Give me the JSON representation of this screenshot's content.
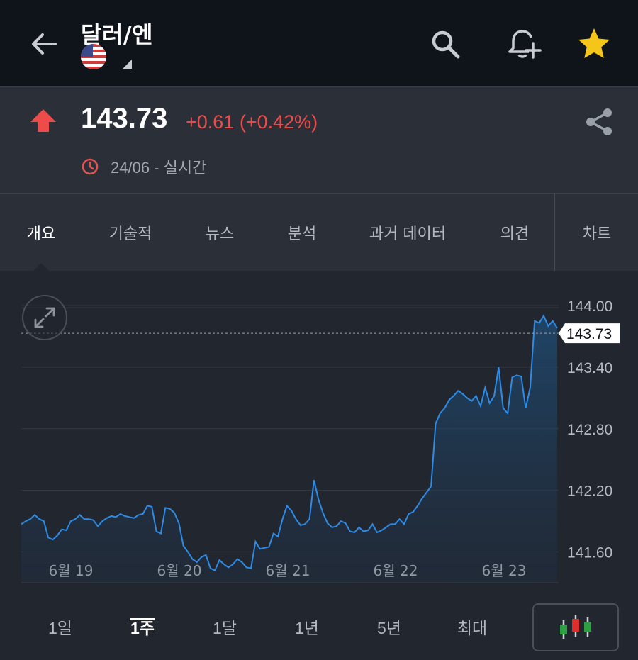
{
  "header": {
    "title": "달러/엔",
    "icons": {
      "back": "back-arrow-icon",
      "search": "search-icon",
      "alert": "add-alert-icon",
      "favorite": "star-icon"
    },
    "colors": {
      "favorite_star": "#f5c518"
    }
  },
  "quote": {
    "price": "143.73",
    "change": "+0.61 (+0.42%)",
    "direction": "up",
    "timestamp": "24/06 - 실시간",
    "colors": {
      "up": "#ee4b4b"
    }
  },
  "tabs": [
    {
      "label": "개요",
      "active": true
    },
    {
      "label": "기술적",
      "active": false
    },
    {
      "label": "뉴스",
      "active": false
    },
    {
      "label": "분석",
      "active": false
    },
    {
      "label": "과거 데이터",
      "active": false
    },
    {
      "label": "의견",
      "active": false
    },
    {
      "label": "차트",
      "active": false
    }
  ],
  "periods": [
    {
      "label": "1일",
      "active": false
    },
    {
      "label": "1주",
      "active": true
    },
    {
      "label": "1달",
      "active": false
    },
    {
      "label": "1년",
      "active": false
    },
    {
      "label": "5년",
      "active": false
    },
    {
      "label": "최대",
      "active": false
    }
  ],
  "chart_data": {
    "type": "area",
    "title": "",
    "xlabel": "",
    "ylabel": "",
    "x_ticks": [
      "6월 19",
      "6월 20",
      "6월 21",
      "6월 22",
      "6월 23"
    ],
    "y_ticks": [
      "144.00",
      "143.40",
      "142.80",
      "142.20",
      "141.60"
    ],
    "ylim": [
      141.3,
      144.2
    ],
    "current_value": 143.73,
    "current_label": "143.73",
    "grid": true,
    "line_color": "#2e8be6",
    "series": [
      {
        "values": [
          141.87,
          141.9,
          141.92,
          141.96,
          141.92,
          141.9,
          141.74,
          141.72,
          141.76,
          141.82,
          141.81,
          141.9,
          141.92,
          141.96,
          141.92,
          141.92,
          141.91,
          141.85,
          141.9,
          141.93,
          141.95,
          141.94,
          141.97,
          141.95,
          141.94,
          141.93,
          141.96,
          141.97,
          142.05,
          142.04,
          141.8,
          141.78,
          142.03,
          142.02,
          141.98,
          141.88,
          141.66,
          141.6,
          141.53,
          141.5,
          141.55,
          141.57,
          141.44,
          141.42,
          141.52,
          141.48,
          141.45,
          141.48,
          141.53,
          141.5,
          141.45,
          141.44,
          141.7,
          141.63,
          141.64,
          141.65,
          141.78,
          141.75,
          141.92,
          142.05,
          142.0,
          141.92,
          141.86,
          141.87,
          141.92,
          142.3,
          142.11,
          141.98,
          141.88,
          141.84,
          141.85,
          141.9,
          141.88,
          141.8,
          141.79,
          141.84,
          141.8,
          141.81,
          141.87,
          141.79,
          141.81,
          141.84,
          141.87,
          141.87,
          141.92,
          141.87,
          141.97,
          141.99,
          142.05,
          142.12,
          142.18,
          142.24,
          142.85,
          142.95,
          143.0,
          143.08,
          143.12,
          143.17,
          143.14,
          143.1,
          143.07,
          143.12,
          143.02,
          143.2,
          143.05,
          143.12,
          143.4,
          143.0,
          142.95,
          143.3,
          143.32,
          143.31,
          143.0,
          143.2,
          143.85,
          143.83,
          143.9,
          143.8,
          143.85,
          143.78
        ]
      }
    ]
  }
}
